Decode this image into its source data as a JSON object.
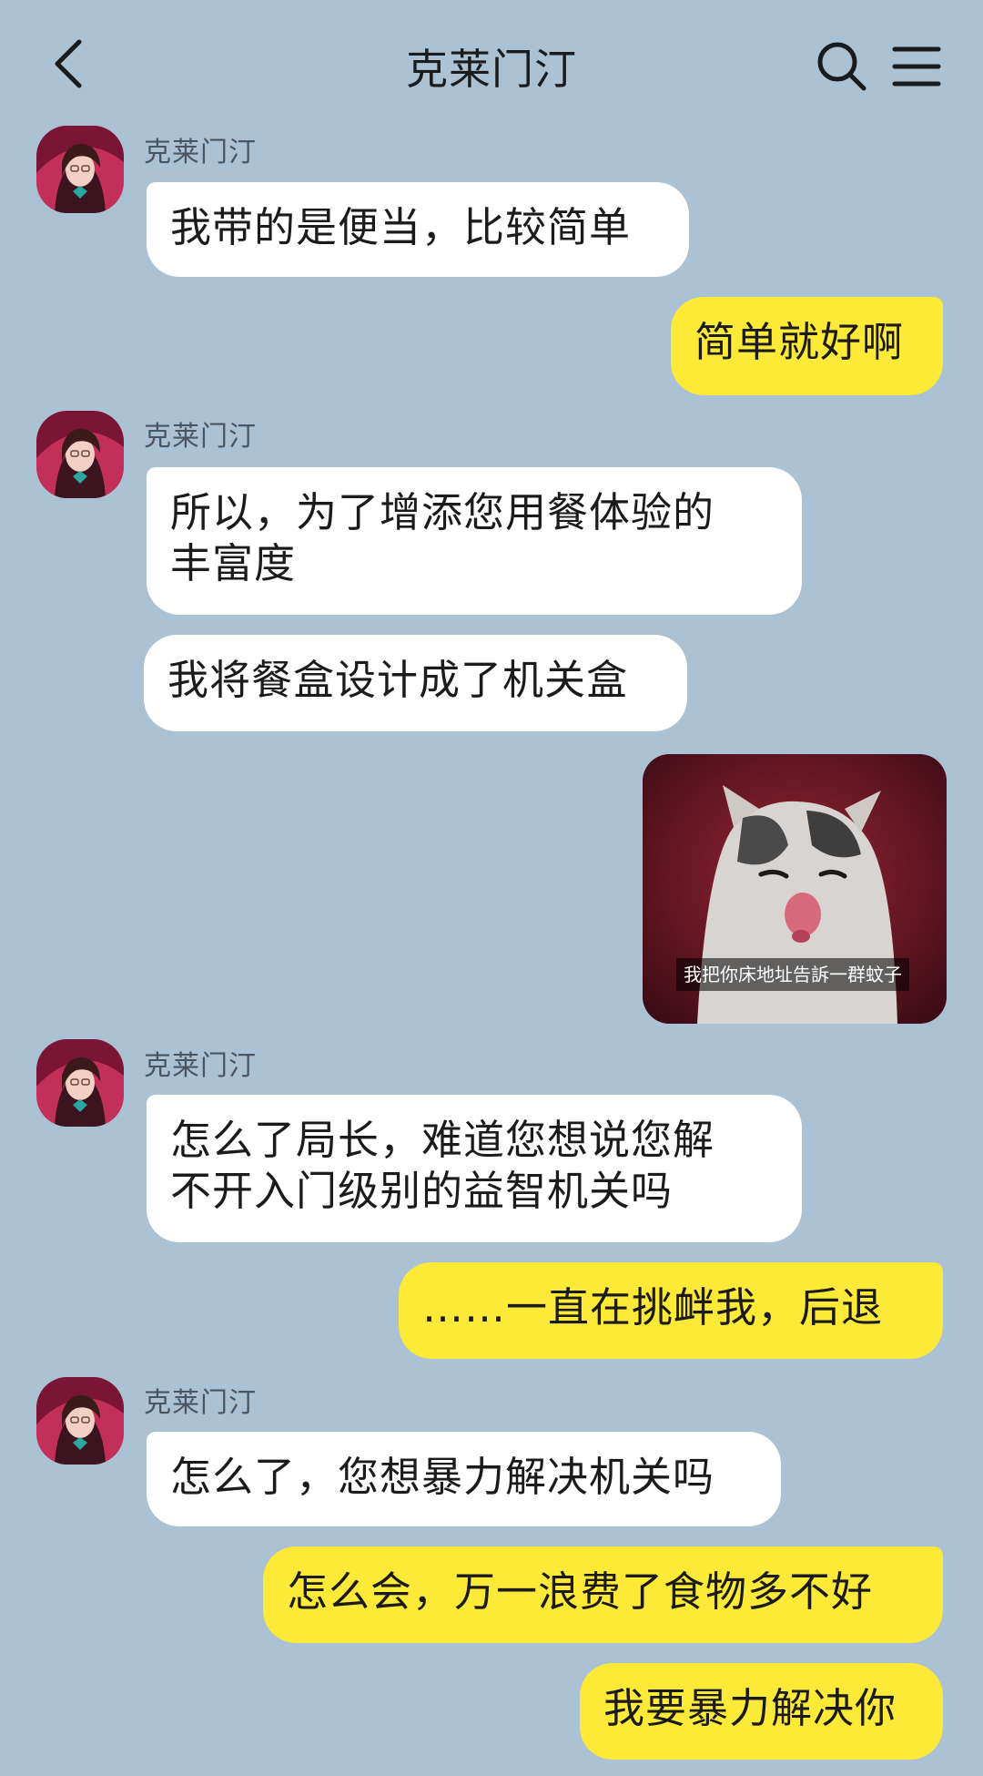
{
  "header": {
    "title": "克莱门汀",
    "back_icon": "chevron-left-icon",
    "search_icon": "search-icon",
    "menu_icon": "menu-icon"
  },
  "colors": {
    "background": "#abc1d4",
    "incoming_bubble": "#ffffff",
    "outgoing_bubble": "#fde937"
  },
  "messages": [
    {
      "from": "克莱门汀",
      "text": "我带的是便当，比较简单"
    },
    {
      "from": "me",
      "text": "简单就好啊"
    },
    {
      "from": "克莱门汀",
      "text": "所以，为了增添您用餐体验的\n丰富度"
    },
    {
      "from": "克莱门汀",
      "text": "我将餐盒设计成了机关盒"
    },
    {
      "from": "me",
      "type": "image",
      "caption": "我把你床地址告訴一群蚊子"
    },
    {
      "from": "克莱门汀",
      "text": "怎么了局长，难道您想说您解\n不开入门级别的益智机关吗"
    },
    {
      "from": "me",
      "text": "……一直在挑衅我，后退"
    },
    {
      "from": "克莱门汀",
      "text": "怎么了，您想暴力解决机关吗"
    },
    {
      "from": "me",
      "text": "怎么会，万一浪费了食物多不好"
    },
    {
      "from": "me",
      "text": "我要暴力解决你"
    }
  ]
}
